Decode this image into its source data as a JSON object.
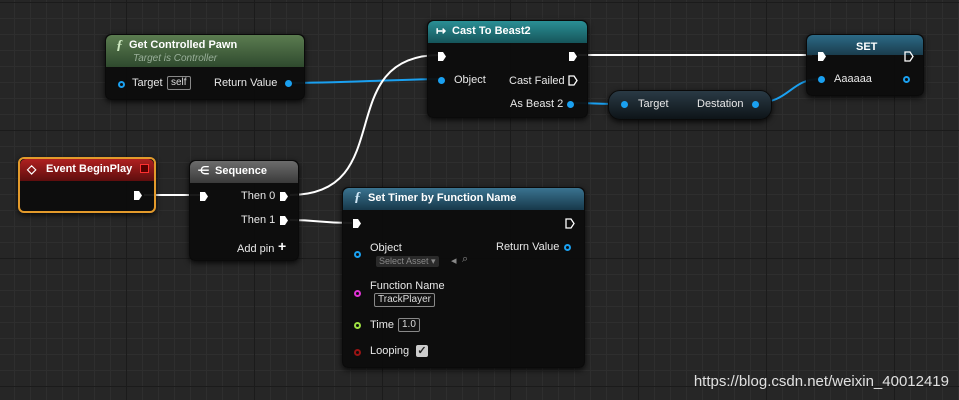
{
  "nodes": {
    "get_pawn": {
      "title": "Get Controlled Pawn",
      "subtitle": "Target is Controller",
      "target_label": "Target",
      "target_value": "self",
      "return_label": "Return Value"
    },
    "cast": {
      "title": "Cast To Beast2",
      "object_label": "Object",
      "cast_failed_label": "Cast Failed",
      "as_label": "As Beast 2"
    },
    "set": {
      "title": "SET",
      "var_label": "Aaaaaa"
    },
    "getter": {
      "target_label": "Target",
      "var_label": "Destation"
    },
    "begin_play": {
      "title": "Event BeginPlay"
    },
    "sequence": {
      "title": "Sequence",
      "then0": "Then 0",
      "then1": "Then 1",
      "add_pin": "Add pin"
    },
    "set_timer": {
      "title": "Set Timer by Function Name",
      "object_label": "Object",
      "select_asset": "Select Asset",
      "return_label": "Return Value",
      "fn_label": "Function Name",
      "fn_value": "TrackPlayer",
      "time_label": "Time",
      "time_value": "1.0",
      "looping_label": "Looping",
      "looping_checked": true
    }
  },
  "watermark": "https://blog.csdn.net/weixin_40012419",
  "colors": {
    "object_pin": "#1aa0f0",
    "func_header": "#2c5f78",
    "pure_header": "#3f6b3a",
    "event_header": "#8e1d1d",
    "cast_header": "#1f7f88"
  }
}
